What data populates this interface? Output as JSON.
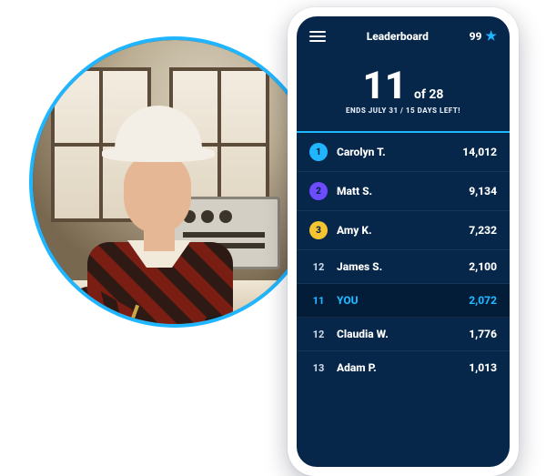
{
  "colors": {
    "accent": "#1fb6ff",
    "screen_bg": "#06274a",
    "highlight_row_bg": "#031d38",
    "chip_gold": "#f5c531",
    "chip_blue": "#1fb6ff",
    "chip_purple": "#6d4bff"
  },
  "header": {
    "title": "Leaderboard",
    "credits": "99"
  },
  "rank": {
    "position": "11",
    "of_label": "of",
    "total": "28",
    "subtext": "ENDS JULY 31 / 15 DAYS LEFT!"
  },
  "rows": [
    {
      "rank": "1",
      "name": "Carolyn T.",
      "score": "14,012",
      "chip_color": "#1fb6ff",
      "highlight": false
    },
    {
      "rank": "2",
      "name": "Matt S.",
      "score": "9,134",
      "chip_color": "#6d4bff",
      "highlight": false
    },
    {
      "rank": "3",
      "name": "Amy K.",
      "score": "7,232",
      "chip_color": "#f5c531",
      "highlight": false
    },
    {
      "rank": "12",
      "name": "James S.",
      "score": "2,100",
      "chip_color": null,
      "highlight": false
    },
    {
      "rank": "11",
      "name": "YOU",
      "score": "2,072",
      "chip_color": null,
      "highlight": true
    },
    {
      "rank": "12",
      "name": "Claudia W.",
      "score": "1,776",
      "chip_color": null,
      "highlight": false
    },
    {
      "rank": "13",
      "name": "Adam P.",
      "score": "1,013",
      "chip_color": null,
      "highlight": false
    }
  ],
  "photo": {
    "alt": "Worker in a white hard hat and plaid shirt writing on blueprints"
  }
}
